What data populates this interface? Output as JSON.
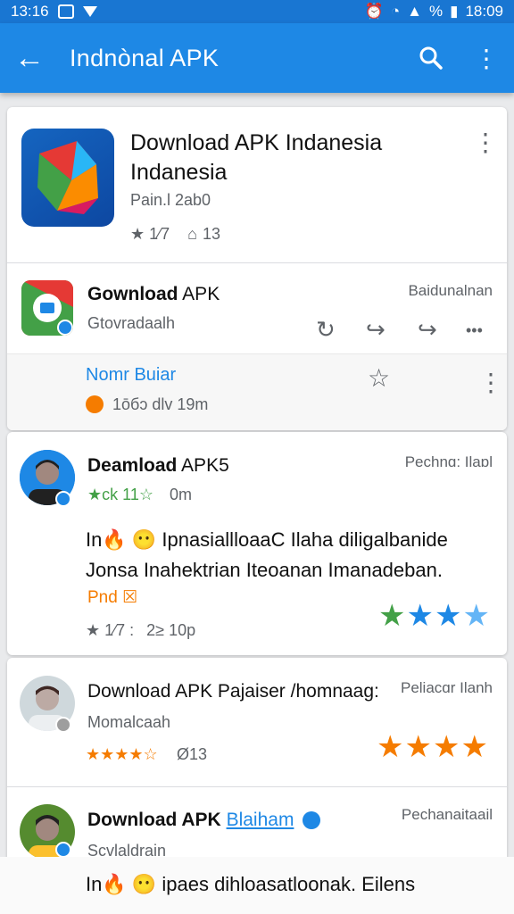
{
  "status_bar": {
    "time_left": "13:16",
    "time_right": "18:09",
    "battery": "%"
  },
  "app_bar": {
    "title": "Indnònal APK",
    "back_label": "←",
    "search_label": "⚲",
    "menu_label": "⋮"
  },
  "featured": {
    "title": "Download APK Indanesia Indanesia",
    "publisher": "Pain.l 2ab0",
    "rating_short": "★ 1⁄7",
    "downloads": "13",
    "menu_label": "⋮"
  },
  "app_row": {
    "title_bold": "Gownload",
    "title_rest": " APK",
    "subtitle": "Gtovradaalh",
    "side_label": "Baidunalnan",
    "actions": [
      "↻",
      "↪",
      "↪",
      "•••"
    ]
  },
  "meta_row": {
    "name": "Nomr Buiar",
    "info": "1ōбɔ dlv  19m",
    "star": "☆",
    "menu_label": "⋮"
  },
  "review1": {
    "author_bold": "Deamload",
    "author_rest": " APK5",
    "side_label": "Pechnɑ: Ilaɒl",
    "rating": "★ck 11☆",
    "time": "0m",
    "body_line1": "In🔥 😶 IpnasiallloaaC Ilaha diligalbanide",
    "body_line2": "Jonsa Inahektrian Iteoanan Imanadeban.",
    "tag": "Pnd ☒",
    "rating_short": "★ 1⁄7 :",
    "comments": "2≥ 10p",
    "stars": [
      "★",
      "★",
      "★",
      "★"
    ]
  },
  "review2": {
    "author": "Download APK Pajaiser /homnaag:",
    "side_label": "Peliacɑr Ilanh",
    "subtitle": "Momalcaah",
    "rating": "★★★★☆",
    "count": "Ø13",
    "stars": [
      "★",
      "★",
      "★",
      "★",
      "★"
    ]
  },
  "review3": {
    "author_bold": "Download APK ",
    "author_link": "Blaiham",
    "side_label": "Pechanaitaail",
    "subtitle": "Scvlaldrain"
  },
  "bottom": {
    "text": "In🔥 😶 ipaes dihloasatloonak. Eilens"
  },
  "colors": {
    "primary": "#1e88e5",
    "status": "#1976d2",
    "accent_orange": "#f57c00",
    "green": "#43a047",
    "link": "#1e88e5"
  }
}
